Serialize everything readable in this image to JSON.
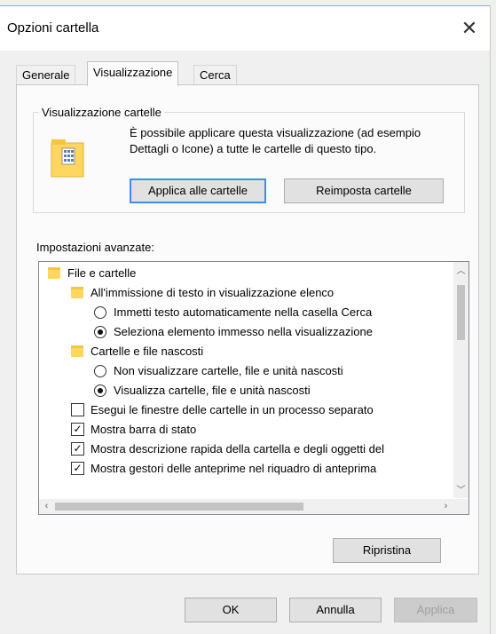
{
  "dialog": {
    "title": "Opzioni cartella",
    "close_glyph": "✕"
  },
  "tabs": [
    {
      "label": "Generale",
      "active": false
    },
    {
      "label": "Visualizzazione",
      "active": true
    },
    {
      "label": "Cerca",
      "active": false
    }
  ],
  "folder_views": {
    "group_title": "Visualizzazione cartelle",
    "description": "È possibile applicare questa visualizzazione (ad esempio Dettagli o Icone) a tutte le cartelle di questo tipo.",
    "apply_button": "Applica alle cartelle",
    "reset_button": "Reimposta cartelle",
    "icon": "folder-icon"
  },
  "advanced": {
    "label": "Impostazioni avanzate:",
    "items": [
      {
        "kind": "folder",
        "level": 0,
        "text": "File e cartelle"
      },
      {
        "kind": "folder",
        "level": 1,
        "text": "All'immissione di testo in visualizzazione elenco"
      },
      {
        "kind": "radio",
        "level": 2,
        "checked": false,
        "text": "Immetti testo automaticamente nella casella Cerca"
      },
      {
        "kind": "radio",
        "level": 2,
        "checked": true,
        "text": "Seleziona elemento immesso nella visualizzazione"
      },
      {
        "kind": "folder",
        "level": 1,
        "text": "Cartelle e file nascosti"
      },
      {
        "kind": "radio",
        "level": 2,
        "checked": false,
        "text": "Non visualizzare cartelle, file e unità nascosti"
      },
      {
        "kind": "radio",
        "level": 2,
        "checked": true,
        "text": "Visualizza cartelle, file e unità nascosti"
      },
      {
        "kind": "check",
        "level": 1,
        "checked": false,
        "text": "Esegui le finestre delle cartelle in un processo separato"
      },
      {
        "kind": "check",
        "level": 1,
        "checked": true,
        "text": "Mostra barra di stato"
      },
      {
        "kind": "check",
        "level": 1,
        "checked": true,
        "text": "Mostra descrizione rapida della cartella e degli oggetti del"
      },
      {
        "kind": "check",
        "level": 1,
        "checked": true,
        "text": "Mostra gestori delle anteprime nel riquadro di anteprima"
      }
    ],
    "restore_button": "Ripristina"
  },
  "footer": {
    "ok_button": "OK",
    "cancel_button": "Annulla",
    "apply_button": "Applica"
  },
  "colors": {
    "accent": "#3d8ee6",
    "folder": "#ffd760"
  }
}
